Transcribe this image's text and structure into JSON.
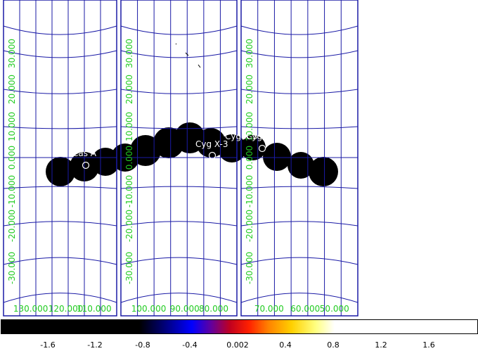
{
  "colors": {
    "background": "#ffffff",
    "frame": "#1a1aa6",
    "grid": "#1a1aa6",
    "axis_labels": "#22cc22",
    "source_marker": "#ffffff",
    "emission": "#000000"
  },
  "panels": [
    {
      "name": "left",
      "vertical_labels": [
        "30.000",
        "20.000",
        "10.000",
        "0.000",
        "-10.000",
        "-20.000",
        "-30.000"
      ],
      "bottom_labels": [
        "130.000",
        "120.000",
        "110.000"
      ]
    },
    {
      "name": "middle",
      "vertical_labels": [
        "30.000",
        "20.000",
        "10.000",
        "0.000",
        "-10.000",
        "-20.000",
        "-30.000"
      ],
      "bottom_labels": [
        "100.000",
        "90.000",
        "80.000"
      ]
    },
    {
      "name": "right",
      "vertical_labels": [
        "30.000",
        "20.000",
        "10.000",
        "0.000",
        "-10.000",
        "-20.000",
        "-30.000"
      ],
      "bottom_labels": [
        "70.000",
        "60.000",
        "50.000"
      ]
    }
  ],
  "sources": [
    {
      "label": "Cas A"
    },
    {
      "label": "Cyg X-3"
    },
    {
      "label": "Cyg X-3"
    },
    {
      "label": "Cyg X"
    }
  ],
  "colorbar": {
    "ticks": [
      "-1.6",
      "-1.2",
      "-0.8",
      "-0.4",
      "0.002",
      "0.4",
      "0.8",
      "1.2",
      "1.6"
    ]
  }
}
